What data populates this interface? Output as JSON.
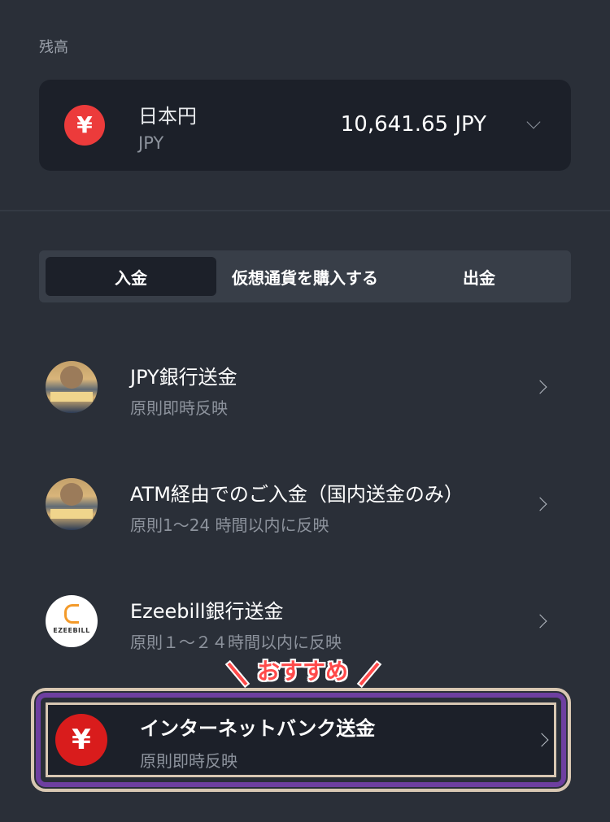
{
  "balance": {
    "section_label": "残高",
    "currency_symbol": "¥",
    "currency_name": "日本円",
    "currency_code": "JPY",
    "amount": "10,641.65 JPY"
  },
  "tabs": [
    {
      "label": "入金",
      "selected": true
    },
    {
      "label": "仮想通貨を購入する",
      "selected": false
    },
    {
      "label": "出金",
      "selected": false
    }
  ],
  "methods": [
    {
      "title": "JPY銀行送金",
      "subtitle": "原則即時反映",
      "icon": "bank-photo-icon"
    },
    {
      "title": "ATM経由でのご入金（国内送金のみ）",
      "subtitle": "原則1〜24 時間以内に反映",
      "icon": "bank-photo-icon"
    },
    {
      "title": "Ezeebill銀行送金",
      "subtitle": "原則１〜２４時間以内に反映",
      "icon": "ezeebill-logo-icon",
      "logo_text": "EZEEBILL"
    }
  ],
  "recommended": {
    "label": "おすすめ",
    "title": "インターネットバンク送金",
    "subtitle": "原則即時反映",
    "currency_symbol": "¥"
  },
  "colors": {
    "background": "#2a2f38",
    "card": "#1c2029",
    "accent_red": "#ec3b3b",
    "highlight_purple": "#6e3fa0",
    "highlight_beige": "#d8c7b2"
  }
}
